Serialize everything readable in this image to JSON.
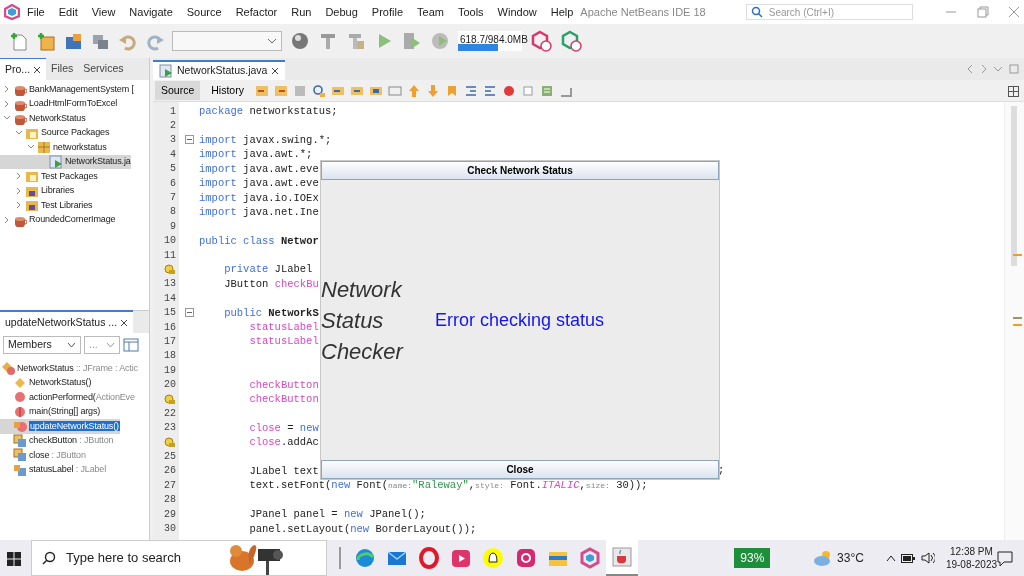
{
  "menu_bar": {
    "items": [
      "File",
      "Edit",
      "View",
      "Navigate",
      "Source",
      "Refactor",
      "Run",
      "Debug",
      "Profile",
      "Team",
      "Tools",
      "Window",
      "Help"
    ],
    "title": "Apache NetBeans IDE 18",
    "search": {
      "placeholder": "Search (Ctrl+I)"
    }
  },
  "toolbar": {
    "memory": {
      "reading": "618.7/984.0MB",
      "level": 0.63
    }
  },
  "projects_panel": {
    "tabs": [
      {
        "label": "Pro...",
        "selected": true
      },
      {
        "label": "Files",
        "selected": false
      },
      {
        "label": "Services",
        "selected": false
      }
    ],
    "tree": [
      {
        "label": "BankManagementSystem [",
        "kind": "project",
        "expanded": false,
        "selected": false
      },
      {
        "label": "LoadHtmlFormToExcel",
        "kind": "project",
        "expanded": false,
        "selected": false
      },
      {
        "label": "NetworkStatus",
        "kind": "project",
        "expanded": true,
        "selected": false,
        "children": [
          {
            "label": "Source Packages",
            "kind": "sources",
            "expanded": true,
            "selected": false,
            "children": [
              {
                "label": "networkstatus",
                "kind": "package",
                "expanded": true,
                "selected": false,
                "children": [
                  {
                    "label": "NetworkStatus.ja",
                    "kind": "java",
                    "selected": true
                  }
                ]
              }
            ]
          },
          {
            "label": "Test Packages",
            "kind": "sources",
            "expanded": false,
            "selected": false
          },
          {
            "label": "Libraries",
            "kind": "library",
            "expanded": false,
            "selected": false
          },
          {
            "label": "Test Libraries",
            "kind": "library",
            "expanded": false,
            "selected": false
          }
        ]
      },
      {
        "label": "RoundedCornerImage",
        "kind": "project",
        "expanded": false,
        "selected": false
      }
    ]
  },
  "navigator": {
    "tab": "updateNetworkStatus ...",
    "filter": "Members",
    "filter_2": "...",
    "members": [
      {
        "label": "NetworkStatus",
        "detail": " :: JFrame : Actic",
        "kind": "class",
        "selected": false,
        "children": [
          {
            "label": "NetworkStatus()",
            "kind": "constructor",
            "selected": false
          },
          {
            "label": "actionPerformed(",
            "detail": "ActionEve",
            "kind": "method",
            "selected": false
          },
          {
            "label": "main(String[] args)",
            "kind": "static",
            "selected": false
          },
          {
            "label": "updateNetworkStatus()",
            "kind": "private-method",
            "selected": true
          },
          {
            "label": "checkButton",
            "detail": " : JButton",
            "kind": "field",
            "selected": false
          },
          {
            "label": "close",
            "detail": " : JButton",
            "kind": "field",
            "selected": false
          },
          {
            "label": "statusLabel",
            "detail": " : JLabel",
            "kind": "private-field",
            "selected": false
          }
        ]
      }
    ]
  },
  "editor": {
    "tabs": [
      {
        "label": "NetworkStatus.java",
        "selected": true
      }
    ],
    "views": [
      {
        "label": "Source",
        "selected": true
      },
      {
        "label": "History",
        "selected": false
      }
    ],
    "lines": [
      {
        "number": "1",
        "code": [
          {
            "kind": "keyword",
            "text": "package"
          },
          {
            "text": " networkstatus;"
          }
        ]
      },
      {
        "number": "2"
      },
      {
        "number": "3",
        "fold": true,
        "code": [
          {
            "kind": "keyword",
            "text": "import"
          },
          {
            "text": " javax.swing.*;"
          }
        ]
      },
      {
        "number": "4",
        "code": [
          {
            "kind": "keyword",
            "text": "import"
          },
          {
            "text": " java.awt.*;"
          }
        ]
      },
      {
        "number": "5",
        "code": [
          {
            "kind": "keyword",
            "text": "import"
          },
          {
            "text": " java.awt.eve"
          }
        ]
      },
      {
        "number": "6",
        "code": [
          {
            "kind": "keyword",
            "text": "import"
          },
          {
            "text": " java.awt.eve"
          }
        ]
      },
      {
        "number": "7",
        "code": [
          {
            "kind": "keyword",
            "text": "import"
          },
          {
            "text": " java.io.IOEx"
          }
        ]
      },
      {
        "number": "8",
        "code": [
          {
            "kind": "keyword",
            "text": "import"
          },
          {
            "text": " java.net.Ine"
          }
        ]
      },
      {
        "number": "9"
      },
      {
        "number": "10",
        "code": [
          {
            "kind": "keyword",
            "text": "public class"
          },
          {
            "kind": "bold",
            "text": " Networ"
          }
        ]
      },
      {
        "number": "11"
      },
      {
        "hint": true,
        "code": [
          {
            "kind": "keyword",
            "text": "    private"
          },
          {
            "text": " JLabel"
          }
        ]
      },
      {
        "number": "13",
        "code": [
          {
            "text": "    JButton "
          },
          {
            "kind": "field",
            "text": "checkBu"
          }
        ]
      },
      {
        "number": "14"
      },
      {
        "number": "15",
        "fold": true,
        "code": [
          {
            "kind": "keyword",
            "text": "    public"
          },
          {
            "kind": "bold",
            "text": " NetworkS"
          }
        ]
      },
      {
        "number": "16",
        "code": [
          {
            "kind": "field",
            "text": "        statusLabel"
          }
        ]
      },
      {
        "number": "17",
        "code": [
          {
            "kind": "field",
            "text": "        statusLabel"
          }
        ]
      },
      {
        "number": "18"
      },
      {
        "number": "19"
      },
      {
        "number": "20",
        "code": [
          {
            "kind": "field",
            "text": "        checkButton"
          }
        ]
      },
      {
        "hint": true,
        "code": [
          {
            "kind": "field",
            "text": "        checkButton"
          }
        ]
      },
      {
        "number": "22"
      },
      {
        "number": "23",
        "code": [
          {
            "kind": "field",
            "text": "        close"
          },
          {
            "text": " = "
          },
          {
            "kind": "keyword",
            "text": "new"
          }
        ]
      },
      {
        "hint": true,
        "code": [
          {
            "kind": "field",
            "text": "        close"
          },
          {
            "text": ".addAc"
          }
        ]
      },
      {
        "number": "25"
      },
      {
        "number": "26",
        "code": [
          {
            "text": "        JLabel text"
          }
        ],
        "tail": ";"
      },
      {
        "number": "27",
        "code": [
          {
            "text": "        text.setFont("
          },
          {
            "kind": "keyword",
            "text": "new"
          },
          {
            "text": " Font("
          },
          {
            "kind": "param-hint",
            "text": "name:"
          },
          {
            "kind": "string",
            "text": "\"Raleway\""
          },
          {
            "text": ","
          },
          {
            "kind": "param-hint",
            "text": "style:"
          },
          {
            "text": " Font."
          },
          {
            "kind": "constant",
            "text": "ITALIC"
          },
          {
            "text": ","
          },
          {
            "kind": "param-hint",
            "text": "size:"
          },
          {
            "text": " 30));"
          }
        ]
      },
      {
        "number": "28"
      },
      {
        "number": "29",
        "code": [
          {
            "text": "        JPanel panel = "
          },
          {
            "kind": "keyword",
            "text": "new"
          },
          {
            "text": " JPanel();"
          }
        ]
      },
      {
        "number": "30",
        "code": [
          {
            "text": "        panel.setLayout("
          },
          {
            "kind": "keyword",
            "text": "new"
          },
          {
            "text": " BorderLayout());"
          }
        ]
      }
    ]
  },
  "dialog": {
    "check_button": "Check Network Status",
    "heading": "Network Status Checker",
    "status": "Error checking status",
    "close_button": "Close"
  },
  "taskbar": {
    "search": {
      "placeholder": "Type here to search"
    },
    "apps": [
      {
        "kind": "edge",
        "selected": false
      },
      {
        "kind": "mail",
        "selected": false
      },
      {
        "kind": "opera",
        "selected": false
      },
      {
        "kind": "clipchamp",
        "selected": false
      },
      {
        "kind": "snapchat",
        "selected": false
      },
      {
        "kind": "instagram",
        "selected": false
      },
      {
        "kind": "explorer",
        "selected": false
      },
      {
        "kind": "netbeans",
        "selected": false
      },
      {
        "kind": "java",
        "selected": true
      }
    ],
    "battery": "93%",
    "temperature": "33°C",
    "time": "12:38 PM",
    "date": "19-08-2023"
  }
}
